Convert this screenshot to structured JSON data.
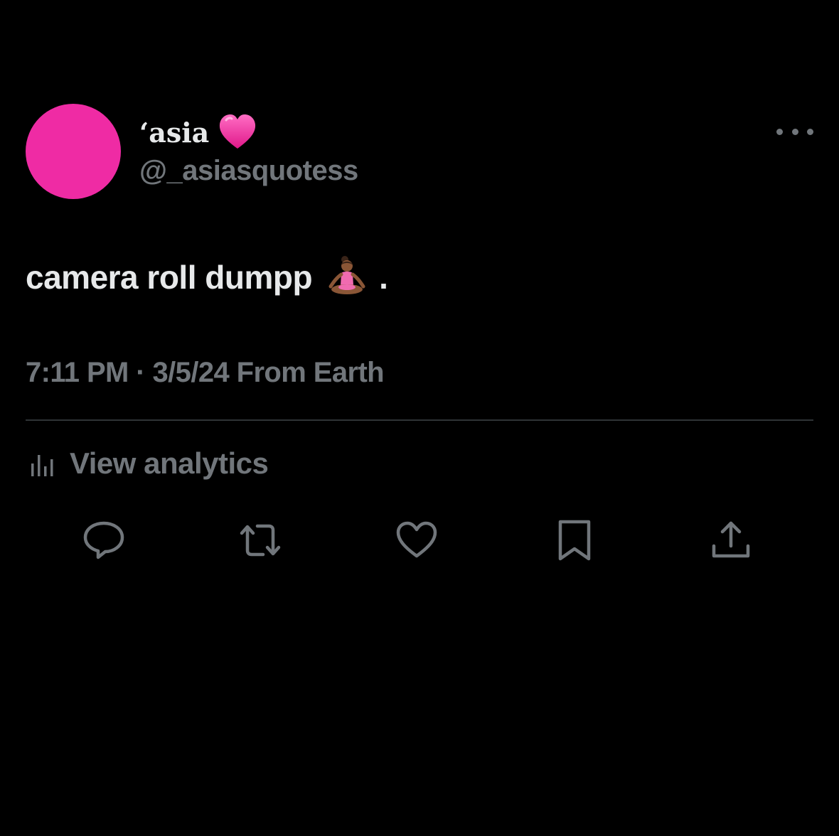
{
  "colors": {
    "background": "#000000",
    "primary_text": "#e7e9ea",
    "secondary_text": "#71767b",
    "avatar": "#ef2ba4",
    "divider": "#2f3336",
    "heart_emoji": "#f0359d"
  },
  "author": {
    "display_name": "‘asia",
    "name_emoji": "pink-heart-icon",
    "handle": "@_asiasquotess"
  },
  "tweet": {
    "text": "camera roll dumpp",
    "emoji": "person-in-lotus-position-icon",
    "trailing": ".",
    "meta": "7:11 PM · 3/5/24 From Earth"
  },
  "analytics": {
    "label": "View analytics",
    "icon": "bar-chart-icon"
  },
  "actions": [
    {
      "name": "reply",
      "icon": "reply-icon"
    },
    {
      "name": "repost",
      "icon": "repost-icon"
    },
    {
      "name": "like",
      "icon": "heart-icon"
    },
    {
      "name": "bookmark",
      "icon": "bookmark-icon"
    },
    {
      "name": "share",
      "icon": "share-icon"
    }
  ],
  "more_menu": {
    "icon": "more-dots-icon"
  }
}
